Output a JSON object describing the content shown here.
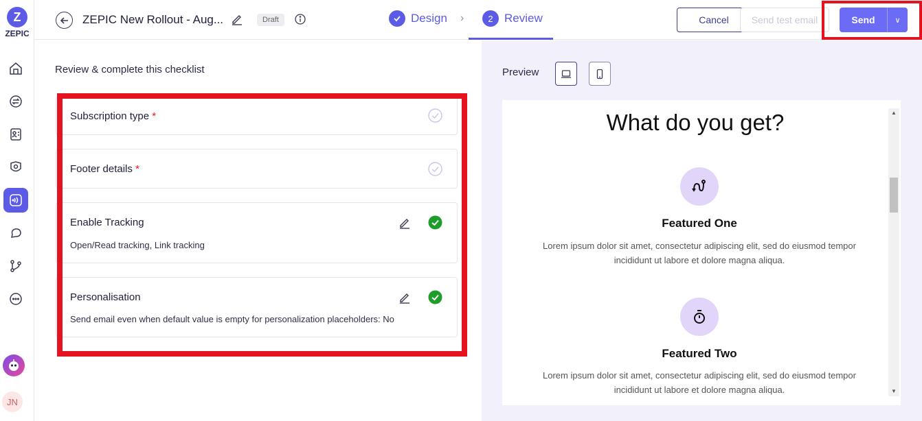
{
  "brand": {
    "name": "ZEPIC",
    "color": "#5b5be6"
  },
  "header": {
    "title": "ZEPIC New Rollout - Aug...",
    "status_badge": "Draft",
    "steps": [
      {
        "label": "Design",
        "state": "done"
      },
      {
        "label": "Review",
        "number": "2",
        "state": "active"
      }
    ],
    "cancel_label": "Cancel",
    "send_test_label": "Send test email",
    "send_label": "Send"
  },
  "sidebar": {
    "items": [
      {
        "icon": "home-icon"
      },
      {
        "icon": "transfer-icon"
      },
      {
        "icon": "contacts-icon"
      },
      {
        "icon": "segments-icon"
      },
      {
        "icon": "broadcast-icon",
        "active": true
      },
      {
        "icon": "chat-icon"
      },
      {
        "icon": "flow-icon"
      },
      {
        "icon": "more-icon"
      }
    ],
    "user_initials": "JN"
  },
  "checklist": {
    "heading": "Review & complete this checklist",
    "items": [
      {
        "title": "Subscription type",
        "required": "*",
        "status": "pending"
      },
      {
        "title": "Footer details",
        "required": "*",
        "status": "pending"
      },
      {
        "title": "Enable Tracking",
        "description": "Open/Read tracking, Link tracking",
        "status": "complete"
      },
      {
        "title": "Personalisation",
        "description": "Send email even when default value is empty for personalization placeholders: No",
        "status": "complete"
      }
    ]
  },
  "preview": {
    "label": "Preview",
    "heading": "What do you get?",
    "features": [
      {
        "title": "Featured One",
        "icon": "route-icon",
        "body": "Lorem ipsum dolor sit amet, consectetur adipiscing elit, sed do eiusmod tempor incididunt ut labore et dolore magna aliqua."
      },
      {
        "title": "Featured Two",
        "icon": "stopwatch-icon",
        "body": "Lorem ipsum dolor sit amet, consectetur adipiscing elit, sed do eiusmod tempor incididunt ut labore et dolore magna aliqua."
      }
    ]
  },
  "colors": {
    "accent": "#6b6bf5",
    "success": "#1f9d2b",
    "highlight": "#e3141f",
    "preview_bg": "#f1f0fb"
  }
}
